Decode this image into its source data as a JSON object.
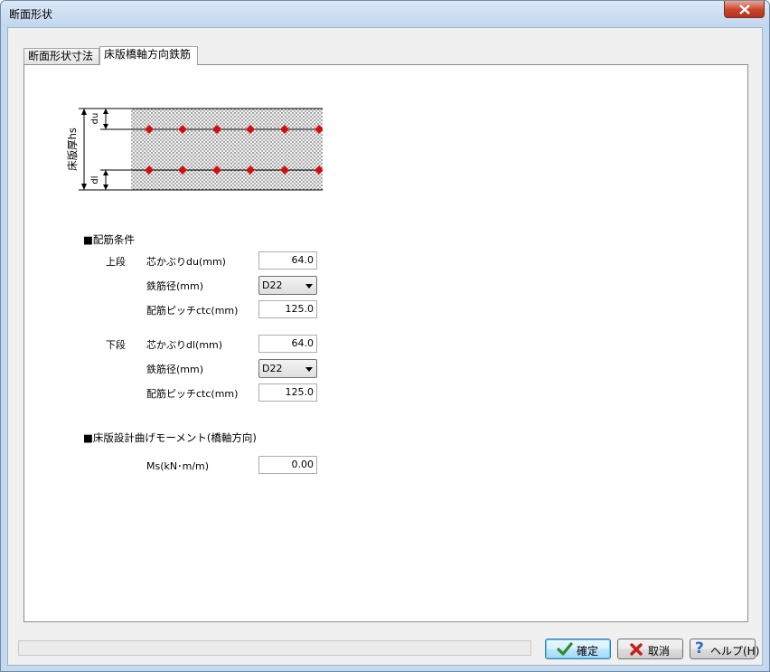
{
  "window": {
    "title": "断面形状"
  },
  "tabs": [
    {
      "label": "断面形状寸法",
      "active": false
    },
    {
      "label": "床版橋軸方向鉄筋",
      "active": true
    }
  ],
  "diagram": {
    "thickness_label": "床版厚hs",
    "top_cover_label": "du",
    "bottom_cover_label": "dl"
  },
  "rebar_section": {
    "title": "■配筋条件",
    "upper": {
      "label": "上段",
      "cover_label": "芯かぶりdu(mm)",
      "cover_value": "64.0",
      "diameter_label": "鉄筋径(mm)",
      "diameter_value": "D22",
      "pitch_label": "配筋ピッチctc(mm)",
      "pitch_value": "125.0"
    },
    "lower": {
      "label": "下段",
      "cover_label": "芯かぶりdl(mm)",
      "cover_value": "64.0",
      "diameter_label": "鉄筋径(mm)",
      "diameter_value": "D22",
      "pitch_label": "配筋ピッチctc(mm)",
      "pitch_value": "125.0"
    }
  },
  "moment_section": {
    "title": "■床版設計曲げモーメント(橋軸方向)",
    "ms_label": "Ms(kN･m/m)",
    "ms_value": "0.00"
  },
  "buttons": {
    "ok": "確定",
    "cancel": "取消",
    "help": "ヘルプ(H)"
  },
  "colors": {
    "rebar": "#d01010",
    "ok_icon": "#2e8b2e",
    "cancel_icon": "#c81e1e",
    "help_icon": "#2a6fc7"
  }
}
